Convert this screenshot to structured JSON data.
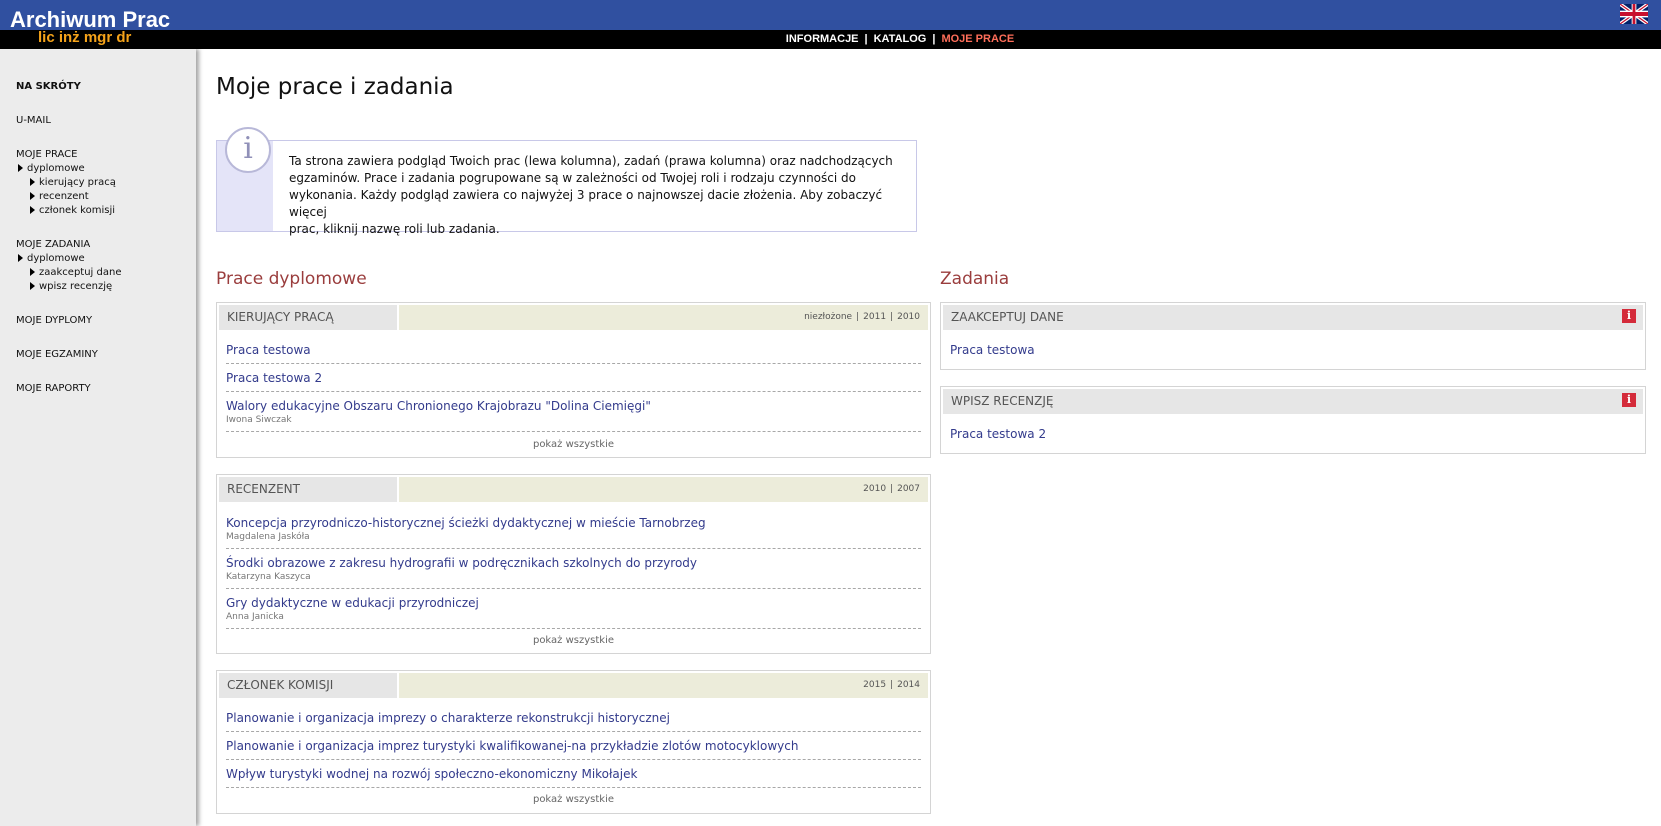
{
  "header": {
    "title": "Archiwum Prac",
    "subtitle": "lic inż mgr dr",
    "nav": [
      {
        "label": "INFORMACJE",
        "active": false
      },
      {
        "label": "KATALOG",
        "active": false
      },
      {
        "label": "MOJE  PRACE",
        "active": true
      }
    ],
    "language_icon": "uk-flag-icon"
  },
  "sidebar": {
    "na_skroty": "NA SKRÓTY",
    "umail": "U-MAIL",
    "moje_prace": {
      "label": "MOJE PRACE",
      "group": "dyplomowe",
      "items": [
        "kierujący pracą",
        "recenzent",
        "członek komisji"
      ]
    },
    "moje_zadania": {
      "label": "MOJE ZADANIA",
      "group": "dyplomowe",
      "items": [
        "zaakceptuj dane",
        "wpisz recenzję"
      ]
    },
    "moje_dyplomy": "MOJE DYPLOMY",
    "moje_egzaminy": "MOJE EGZAMINY",
    "moje_raporty": "MOJE RAPORTY"
  },
  "main": {
    "title": "Moje prace i zadania",
    "info_lines": [
      "Ta strona zawiera podgląd Twoich prac (lewa kolumna), zadań (prawa kolumna) oraz nadchodzących",
      "egzaminów. Prace i zadania pogrupowane są w zależności od Twojej roli i rodzaju czynności do",
      "wykonania. Każdy podgląd zawiera co najwyżej 3 prace o najnowszej dacie złożenia. Aby zobaczyć więcej",
      "prac, kliknij nazwę roli lub zadania."
    ],
    "prace_title": "Prace dyplomowe",
    "zadania_title": "Zadania",
    "show_all": "pokaż wszystkie",
    "kierujacy": {
      "header": "KIERUJĄCY PRACĄ",
      "filters": [
        "niezłożone",
        "2011",
        "2010"
      ],
      "works": [
        {
          "title": "Praca testowa",
          "author": ""
        },
        {
          "title": "Praca testowa 2",
          "author": ""
        },
        {
          "title": "Walory edukacyjne Obszaru Chronionego Krajobrazu \"Dolina Ciemięgi\"",
          "author": "Iwona Siwczak"
        }
      ]
    },
    "recenzent": {
      "header": "RECENZENT",
      "filters": [
        "2010",
        "2007"
      ],
      "works": [
        {
          "title": "Koncepcja przyrodniczo-historycznej ścieżki dydaktycznej w mieście Tarnobrzeg",
          "author": "Magdalena Jaskóła"
        },
        {
          "title": "Środki obrazowe z zakresu hydrografii w podręcznikach szkolnych do przyrody",
          "author": "Katarzyna Kaszyca"
        },
        {
          "title": "Gry dydaktyczne w edukacji przyrodniczej",
          "author": "Anna Janicka"
        }
      ]
    },
    "czlonek": {
      "header": "CZŁONEK KOMISJI",
      "filters": [
        "2015",
        "2014"
      ],
      "works": [
        {
          "title": "Planowanie i organizacja imprezy o charakterze rekonstrukcji historycznej",
          "author": ""
        },
        {
          "title": "Planowanie i organizacja imprez turystyki kwalifikowanej-na przykładzie zlotów motocyklowych",
          "author": ""
        },
        {
          "title": "Wpływ turystyki wodnej na rozwój społeczno-ekonomiczny Mikołajek",
          "author": ""
        }
      ]
    },
    "zaakceptuj": {
      "header": "ZAAKCEPTUJ DANE",
      "works": [
        {
          "title": "Praca testowa"
        }
      ]
    },
    "wpisz": {
      "header": "WPISZ RECENZJĘ",
      "works": [
        {
          "title": "Praca testowa 2"
        }
      ]
    }
  }
}
